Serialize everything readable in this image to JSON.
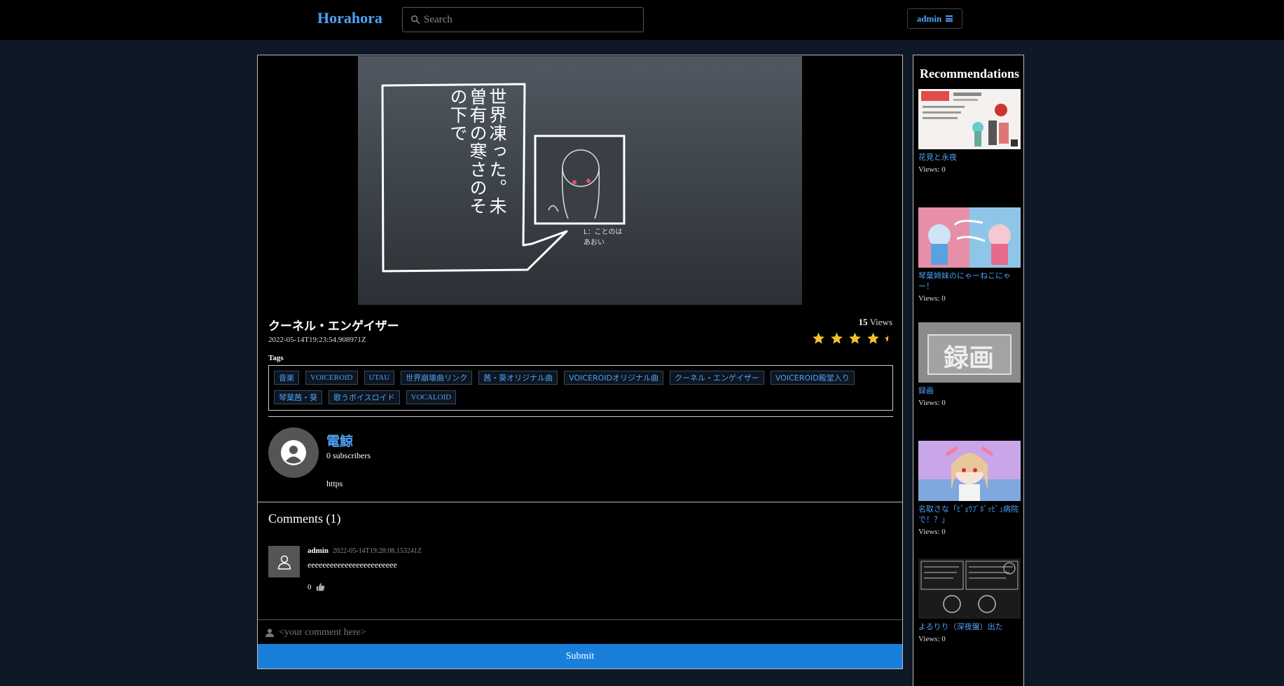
{
  "header": {
    "brand": "Horahora",
    "search_placeholder": "Search",
    "user_label": "admin"
  },
  "video": {
    "title": "クーネル・エンゲイザー",
    "date": "2022-05-14T19:23:54.908971Z",
    "views_count": "15",
    "views_label": "Views",
    "rating": 4.5,
    "thumbnail_text": "世界凍った。未曽有の寒さのその下で",
    "thumbnail_caption": "L：ことのは あおい"
  },
  "tags": {
    "label": "Tags",
    "items": [
      "音楽",
      "VOICEROID",
      "UTAU",
      "世界崩壊曲リンク",
      "茜・葵オリジナル曲",
      "VOICEROIDオリジナル曲",
      "クーネル・エンゲイザー",
      "VOICEROID殿堂入り",
      "琴葉茜・葵",
      "歌うボイスロイド",
      "VOCALOID"
    ]
  },
  "channel": {
    "name": "電鯨",
    "subscribers": "0 subscribers",
    "description": "https"
  },
  "comments": {
    "title": "Comments (1)",
    "items": [
      {
        "author": "admin",
        "date": "2022-05-14T19:28:08.153241Z",
        "text": "eeeeeeeeeeeeeeeeeeeeeeee",
        "likes": "0"
      }
    ],
    "input_placeholder": "<your comment here>",
    "submit_label": "Submit"
  },
  "sidebar": {
    "title": "Recommendations",
    "items": [
      {
        "title": "花見と永夜",
        "views": "Views: 0"
      },
      {
        "title": "琴葉姉妹のにゃーねこにゃー！",
        "views": "Views: 0"
      },
      {
        "title": "録画",
        "views": "Views: 0",
        "thumb_text": "録画"
      },
      {
        "title": "名取さな「ﾋﾞｮｳﾌﾞﾎﾞｯﾋﾞｭ病院で！？」",
        "views": "Views: 0"
      },
      {
        "title": "よるりり（深夜盤）出た",
        "views": "Views: 0"
      }
    ]
  },
  "colors": {
    "accent": "#4ea1f5",
    "submit": "#1a7fdb",
    "star": "#f2c12e",
    "page_bg": "#0f1827"
  }
}
